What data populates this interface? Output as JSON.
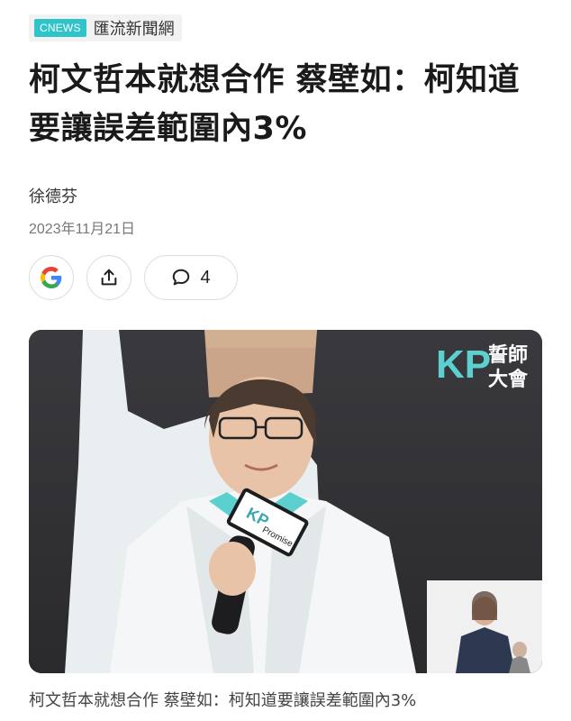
{
  "source": {
    "badge": "CNEWS",
    "name": "匯流新聞網"
  },
  "article": {
    "title": "柯文哲本就想合作  蔡壁如：柯知道要讓誤差範圍內3%",
    "author": "徐德芬",
    "date": "2023年11月21日",
    "caption": "柯文哲本就想合作  蔡壁如：柯知道要讓誤差範圍內3%"
  },
  "actions": {
    "google_icon": "google-icon",
    "share_icon": "share-icon",
    "comment_icon": "comment-icon",
    "comment_count": "4"
  },
  "image": {
    "logo_text": "KP",
    "event_line1": "誓師",
    "event_line2": "大會",
    "mic_flag_text": "KP",
    "mic_flag_sub": "Promise"
  },
  "colors": {
    "accent": "#2ec4c9",
    "kp_teal": "#5ccfcf"
  }
}
